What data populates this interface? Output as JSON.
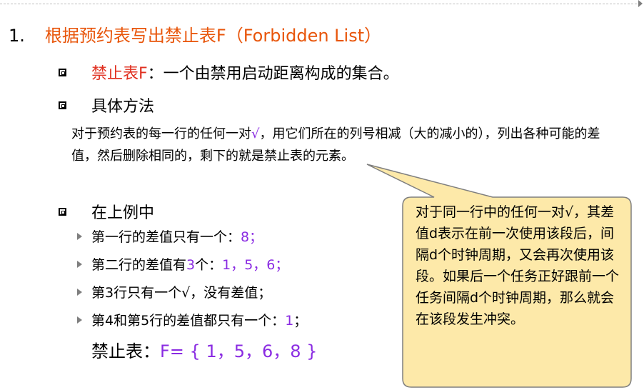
{
  "section_number": "1.",
  "section_title": "根据预约表写出禁止表F（Forbidden List）",
  "definition": {
    "term": "禁止表F",
    "sep": "：",
    "text": "一个由禁用启动距离构成的集合。"
  },
  "method_heading": "具体方法",
  "method_paragraph": {
    "part1": "对于预约表的每一行的任何一对",
    "check": "√",
    "part2": "，用它们所在的列号相减（大的减小的），列出各种可能的差值，然后删除相同的，剩下的就是禁止表的元素。"
  },
  "example_heading": "在上例中",
  "bullets": [
    {
      "pre": "第一行的差值只有一个：",
      "hl": "8",
      "post": "；"
    },
    {
      "pre": "第二行的差值有",
      "hl": "3",
      "mid": "个：",
      "hl2": "1，5，6",
      "post": "；"
    },
    {
      "pre": "第3行只有一个√，没有差值；"
    },
    {
      "pre": "第4和第5行的差值都只有一个：",
      "hl": "1",
      "post": "；"
    }
  ],
  "forbidden_set": {
    "label": "禁止表：",
    "value": "F= { 1，5，6，8 }"
  },
  "callout": {
    "text": "对于同一行中的任何一对√，其差值d表示在前一次使用该段后，间隔d个时钟周期，又会再次使用该段。如果后一个任务正好跟前一个任务间隔d个时钟周期，那么就会在该段发生冲突。",
    "fill": "#fde9a9",
    "stroke": "#7f7f7f"
  },
  "colors": {
    "title": "#e8550a",
    "term": "#e03020",
    "highlight": "#8a2be2"
  }
}
